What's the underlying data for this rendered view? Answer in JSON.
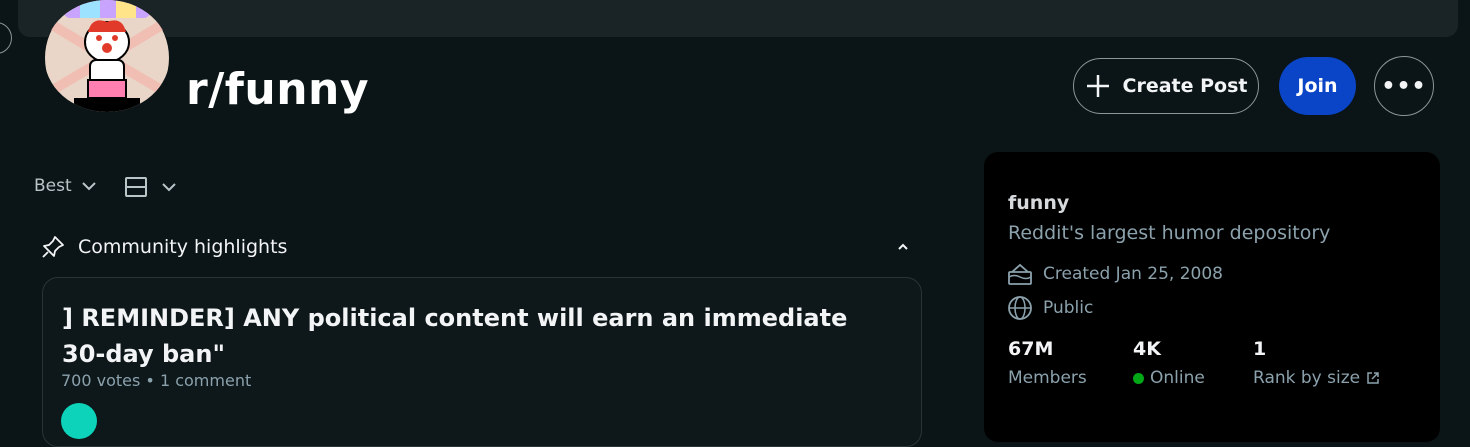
{
  "header": {
    "title": "r/funny",
    "create_post_label": "Create Post",
    "join_label": "Join",
    "more_label": "•••"
  },
  "feed": {
    "sort_label": "Best",
    "highlights_label": "Community highlights",
    "post": {
      "title": "] REMINDER] ANY political content will earn an immediate 30-day ban\"",
      "meta": "700 votes • 1 comment"
    }
  },
  "sidebar": {
    "name": "funny",
    "description": "Reddit's largest humor depository",
    "created": "Created Jan 25, 2008",
    "visibility": "Public",
    "stats": {
      "members_value": "67M",
      "members_label": "Members",
      "online_value": "4K",
      "online_label": "Online",
      "rank_value": "1",
      "rank_label": "Rank by size"
    }
  },
  "colors": {
    "background": "#0b1416",
    "join_button": "#0a45c7",
    "online_dot": "#01a816",
    "muted_text": "#8ba2ad"
  },
  "icons": [
    "plus-icon",
    "more-icon",
    "chevron-down-icon",
    "layout-icon",
    "pin-icon",
    "chevron-up-icon",
    "cake-icon",
    "globe-icon",
    "external-link-icon"
  ]
}
